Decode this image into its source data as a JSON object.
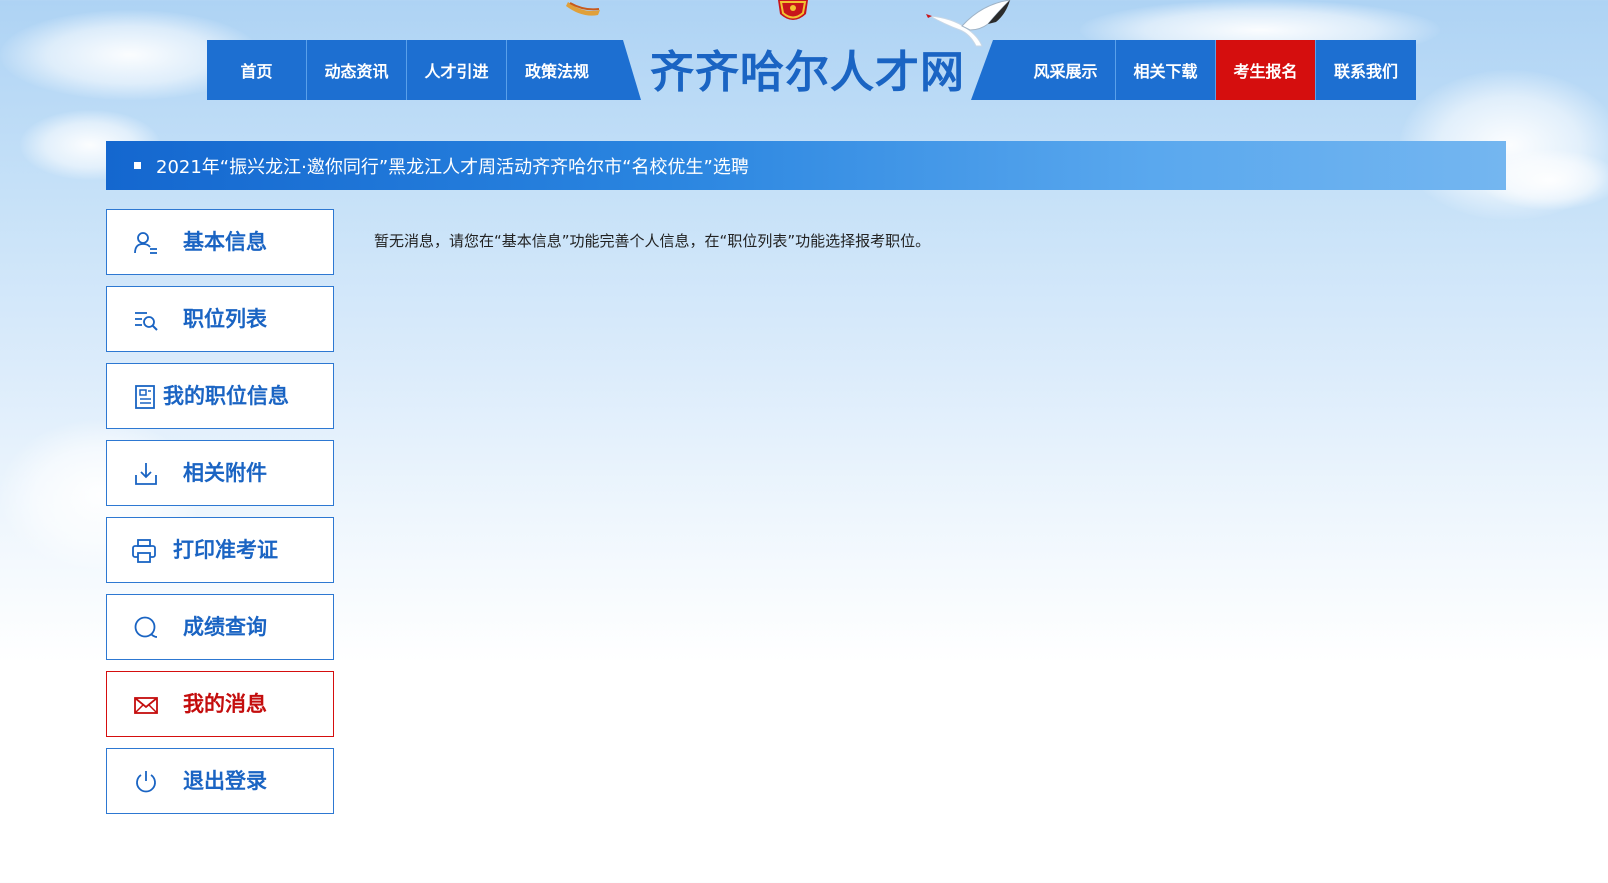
{
  "header": {
    "site_title": "齐齐哈尔人才网",
    "nav_left": [
      "首页",
      "动态资讯",
      "人才引进",
      "政策法规"
    ],
    "nav_right": [
      "风采展示",
      "相关下载",
      "考生报名",
      "联系我们"
    ],
    "highlighted_nav": "考生报名",
    "icons": [
      "national-emblem-icon",
      "crane-icon"
    ]
  },
  "banner": {
    "text": "2021年“振兴龙江·邀你同行”黑龙江人才周活动齐齐哈尔市“名校优生”选聘"
  },
  "sidebar": {
    "items": [
      {
        "label": "基本信息",
        "icon": "user-icon",
        "active": false
      },
      {
        "label": "职位列表",
        "icon": "list-search-icon",
        "active": false
      },
      {
        "label": "我的职位信息",
        "icon": "document-icon",
        "active": false
      },
      {
        "label": "相关附件",
        "icon": "download-icon",
        "active": false
      },
      {
        "label": "打印准考证",
        "icon": "printer-icon",
        "active": false
      },
      {
        "label": "成绩查询",
        "icon": "query-icon",
        "active": false
      },
      {
        "label": "我的消息",
        "icon": "mail-icon",
        "active": true
      },
      {
        "label": "退出登录",
        "icon": "power-icon",
        "active": false
      }
    ]
  },
  "main": {
    "message": "暂无消息，请您在“基本信息”功能完善个人信息，在“职位列表”功能选择报考职位。"
  },
  "colors": {
    "primary": "#1d6fd1",
    "highlight": "#d50e0e",
    "title": "#1a64c3"
  }
}
